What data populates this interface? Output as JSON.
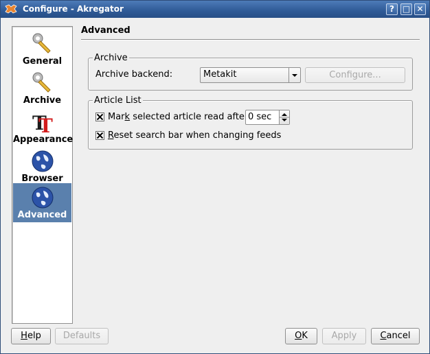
{
  "window": {
    "title": "Configure - Akregator",
    "buttons": {
      "help": "?",
      "maximize": "□",
      "close": "✕"
    }
  },
  "sidebar": {
    "items": [
      {
        "label": "General",
        "icon": "wrench-icon",
        "selected": false
      },
      {
        "label": "Archive",
        "icon": "wrench-icon",
        "selected": false
      },
      {
        "label": "Appearance",
        "icon": "font-icon",
        "selected": false
      },
      {
        "label": "Browser",
        "icon": "globe-icon",
        "selected": false
      },
      {
        "label": "Advanced",
        "icon": "globe-icon",
        "selected": true
      }
    ]
  },
  "page": {
    "title": "Advanced",
    "archive_group": {
      "legend": "Archive",
      "backend_label": "Archive backend:",
      "backend_value": "Metakit",
      "configure_button": "Configure..."
    },
    "article_group": {
      "legend": "Article List",
      "mark_read": {
        "label_pre": "Mar",
        "label_accel": "k",
        "label_post": " selected article read after",
        "checked": true,
        "value": "0 sec"
      },
      "reset_search": {
        "label_accel": "R",
        "label_post": "eset search bar when changing feeds",
        "checked": true
      }
    }
  },
  "footer": {
    "help": {
      "accel": "H",
      "rest": "elp"
    },
    "defaults": "Defaults",
    "ok": {
      "accel": "O",
      "rest": "K"
    },
    "apply": "Apply",
    "cancel": {
      "accel": "C",
      "rest": "ancel"
    }
  },
  "colors": {
    "titlebar": "#2f5a96",
    "selection": "#5a80ad",
    "window_bg": "#efefef"
  }
}
